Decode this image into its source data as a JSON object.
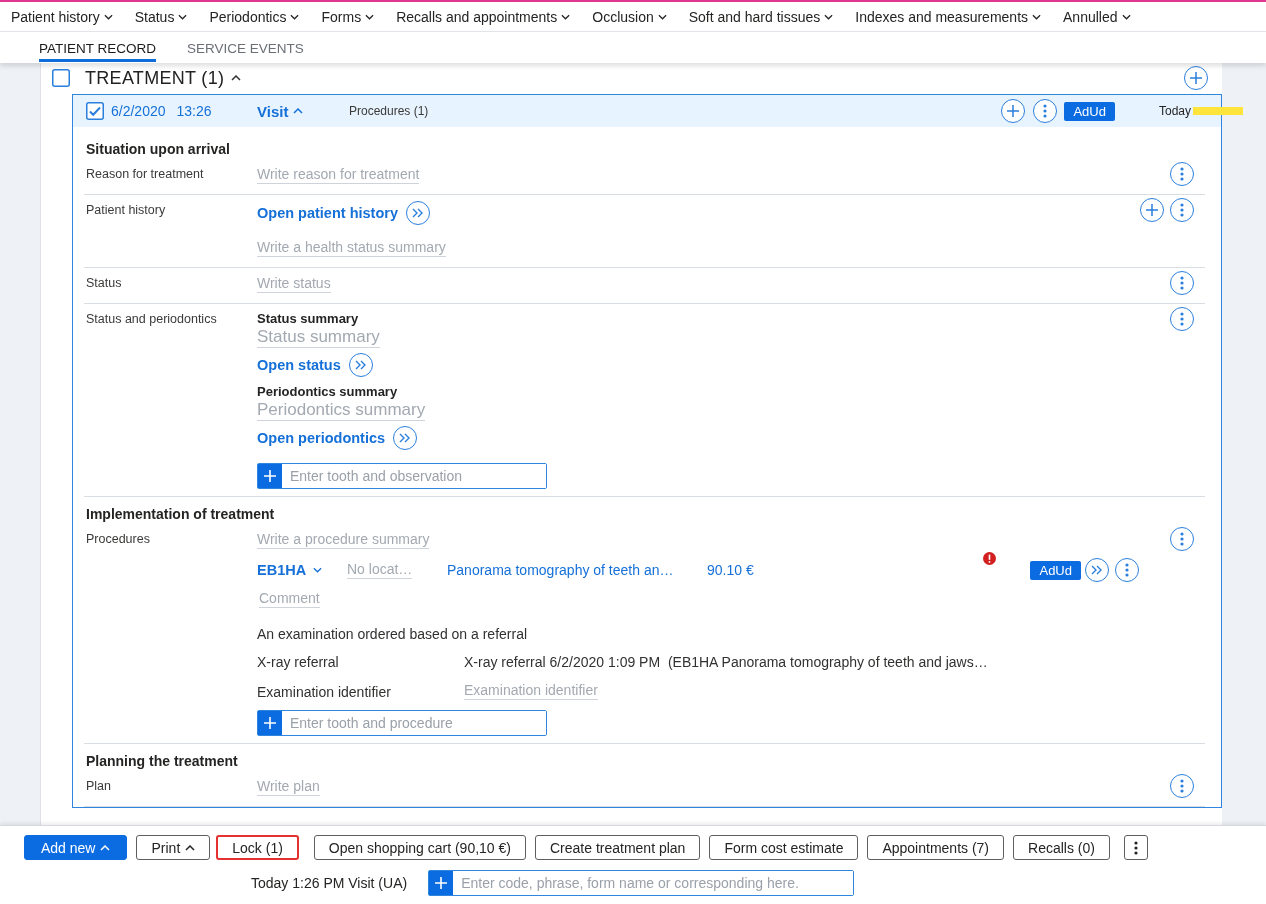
{
  "menu": [
    {
      "label": "Patient history"
    },
    {
      "label": "Status"
    },
    {
      "label": "Periodontics"
    },
    {
      "label": "Forms"
    },
    {
      "label": "Recalls and appointments"
    },
    {
      "label": "Occlusion"
    },
    {
      "label": "Soft and hard tissues"
    },
    {
      "label": "Indexes and measurements"
    },
    {
      "label": "Annulled"
    }
  ],
  "tabs": [
    {
      "label": "PATIENT RECORD",
      "selected": true
    },
    {
      "label": "SERVICE EVENTS",
      "selected": false
    }
  ],
  "treatment": {
    "title": "TREATMENT (1)",
    "checked": false,
    "expanded": true
  },
  "visit": {
    "checked": true,
    "date": "6/2/2020",
    "time": "13:26",
    "type": "Visit",
    "expanded": true,
    "procedures": "Procedures (1)",
    "badge": "AdUd",
    "day": "Today"
  },
  "sections": [
    {
      "title": "Situation upon arrival",
      "rows": [
        {
          "label": "Reason for treatment",
          "addable": false,
          "items": [
            {
              "kind": "field",
              "placeholder": "Write reason for treatment"
            }
          ]
        },
        {
          "label": "Patient history",
          "addable": true,
          "items": [
            {
              "kind": "link",
              "text": "Open patient history"
            },
            {
              "kind": "field",
              "placeholder": "Write a health status summary"
            }
          ]
        },
        {
          "label": "Status",
          "addable": false,
          "items": [
            {
              "kind": "field",
              "placeholder": "Write status"
            }
          ]
        },
        {
          "label": "Status and periodontics",
          "addable": false,
          "items": [
            {
              "kind": "heading",
              "text": "Status summary"
            },
            {
              "kind": "large_field",
              "placeholder": "Status summary"
            },
            {
              "kind": "link",
              "text": "Open status"
            },
            {
              "kind": "heading",
              "text": "Periodontics summary"
            },
            {
              "kind": "large_field",
              "placeholder": "Periodontics summary"
            },
            {
              "kind": "link",
              "text": "Open periodontics"
            },
            {
              "kind": "entry",
              "placeholder": "Enter tooth and observation"
            }
          ]
        }
      ]
    },
    {
      "title": "Implementation of treatment",
      "rows": [
        {
          "label": "Procedures",
          "addable": false,
          "items": [
            {
              "kind": "field",
              "placeholder": "Write a procedure summary"
            },
            {
              "kind": "procedure",
              "code": "EB1HA",
              "location": {
                "placeholder": "No locat…"
              },
              "name": "Panorama tomography of teeth an…",
              "price": "90.10 €",
              "warning": true,
              "badge": "AdUd"
            },
            {
              "kind": "field",
              "placeholder": "Comment"
            },
            {
              "kind": "note",
              "text": "An examination ordered based on a referral"
            },
            {
              "kind": "pair",
              "label": "X-ray referral",
              "value": "X-ray referral 6/2/2020 1:09 PM  (EB1HA Panorama tomography of teeth and jaws…"
            },
            {
              "kind": "pair",
              "label": "Examination identifier",
              "placeholder": "Examination identifier"
            },
            {
              "kind": "entry",
              "placeholder": "Enter tooth and procedure"
            }
          ]
        }
      ]
    },
    {
      "title": "Planning the treatment",
      "rows": [
        {
          "label": "Plan",
          "addable": false,
          "items": [
            {
              "kind": "field",
              "placeholder": "Write plan"
            }
          ]
        }
      ]
    }
  ],
  "actions": [
    {
      "kind": "primary",
      "label": "Add new",
      "menu": true,
      "highlighted": false
    },
    {
      "kind": "secondary",
      "label": "Print",
      "menu": true,
      "highlighted": false
    },
    {
      "kind": "secondary",
      "label": "Lock (1)",
      "menu": false,
      "highlighted": true
    },
    {
      "kind": "secondary",
      "label": "Open shopping cart (90,10 €)",
      "menu": false,
      "highlighted": false
    },
    {
      "kind": "secondary",
      "label": "Create treatment plan",
      "menu": false,
      "highlighted": false
    },
    {
      "kind": "secondary",
      "label": "Form cost estimate",
      "menu": false,
      "highlighted": false
    },
    {
      "kind": "secondary",
      "label": "Appointments (7)",
      "menu": false,
      "highlighted": false
    },
    {
      "kind": "secondary",
      "label": "Recalls (0)",
      "menu": false,
      "highlighted": false
    },
    {
      "kind": "more",
      "highlighted": false
    }
  ],
  "footer": {
    "context": "Today 1:26 PM Visit (UA)",
    "command": {
      "placeholder": "Enter code, phrase, form name or corresponding here."
    }
  }
}
